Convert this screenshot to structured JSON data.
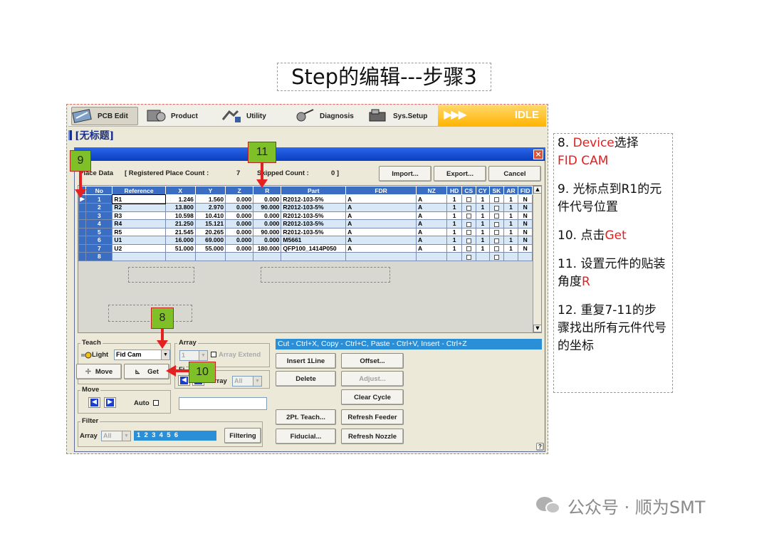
{
  "slide": {
    "title": "Step的编辑---步骤3"
  },
  "toolbar": {
    "tabs": [
      {
        "label": "PCB Edit",
        "icon": "pcb-edit-icon",
        "active": true
      },
      {
        "label": "Product",
        "icon": "product-icon",
        "active": false
      },
      {
        "label": "Utility",
        "icon": "utility-icon",
        "active": false
      },
      {
        "label": "Diagnosis",
        "icon": "diagnosis-icon",
        "active": false
      },
      {
        "label": "Sys.Setup",
        "icon": "sys-setup-icon",
        "active": false
      }
    ],
    "status_arrows": "▶▶▶",
    "status": "IDLE"
  },
  "document": {
    "label": "[无标题]"
  },
  "dialog": {
    "close_glyph": "×",
    "place_data_label": "Place Data",
    "registered_label": "[ Registered Place Count :",
    "registered_value": "7",
    "skipped_label": "Skipped Count :",
    "skipped_value": "0 ]",
    "import_label": "Import...",
    "export_label": "Export...",
    "cancel_label": "Cancel"
  },
  "table": {
    "columns": [
      "No",
      "Reference",
      "X",
      "Y",
      "Z",
      "R",
      "Part",
      "FDR",
      "NZ",
      "HD",
      "CS",
      "CY",
      "SK",
      "AR",
      "FID"
    ],
    "rows": [
      {
        "no": "1",
        "ref": "R1",
        "x": "1.246",
        "y": "1.560",
        "z": "0.000",
        "r": "0.000",
        "part": "R2012-103-5%",
        "fdr": "A",
        "nz": "A",
        "hd": "1",
        "cy": "1",
        "ar": "1",
        "fid": "N"
      },
      {
        "no": "2",
        "ref": "R2",
        "x": "13.800",
        "y": "2.970",
        "z": "0.000",
        "r": "90.000",
        "part": "R2012-103-5%",
        "fdr": "A",
        "nz": "A",
        "hd": "1",
        "cy": "1",
        "ar": "1",
        "fid": "N"
      },
      {
        "no": "3",
        "ref": "R3",
        "x": "10.598",
        "y": "10.410",
        "z": "0.000",
        "r": "0.000",
        "part": "R2012-103-5%",
        "fdr": "A",
        "nz": "A",
        "hd": "1",
        "cy": "1",
        "ar": "1",
        "fid": "N"
      },
      {
        "no": "4",
        "ref": "R4",
        "x": "21.250",
        "y": "15.121",
        "z": "0.000",
        "r": "0.000",
        "part": "R2012-103-5%",
        "fdr": "A",
        "nz": "A",
        "hd": "1",
        "cy": "1",
        "ar": "1",
        "fid": "N"
      },
      {
        "no": "5",
        "ref": "R5",
        "x": "21.545",
        "y": "20.265",
        "z": "0.000",
        "r": "90.000",
        "part": "R2012-103-5%",
        "fdr": "A",
        "nz": "A",
        "hd": "1",
        "cy": "1",
        "ar": "1",
        "fid": "N"
      },
      {
        "no": "6",
        "ref": "U1",
        "x": "16.000",
        "y": "69.000",
        "z": "0.000",
        "r": "0.000",
        "part": "M5661",
        "fdr": "A",
        "nz": "A",
        "hd": "1",
        "cy": "1",
        "ar": "1",
        "fid": "N"
      },
      {
        "no": "7",
        "ref": "U2",
        "x": "51.000",
        "y": "55.000",
        "z": "0.000",
        "r": "180.000",
        "part": "QFP100_1414P050",
        "fdr": "A",
        "nz": "A",
        "hd": "1",
        "cy": "1",
        "ar": "1",
        "fid": "N"
      },
      {
        "no": "8",
        "ref": "",
        "x": "",
        "y": "",
        "z": "",
        "r": "",
        "part": "",
        "fdr": "",
        "nz": "",
        "hd": "",
        "cy": "",
        "ar": "",
        "fid": ""
      }
    ]
  },
  "teach": {
    "title": "Teach",
    "light_label": "Light",
    "device_value": "Fid Cam",
    "move_label": "Move",
    "get_label": "Get"
  },
  "array": {
    "title": "Array",
    "combo_value": "1",
    "extend_label": "Array Extend",
    "find_title": "Fi",
    "array_label": "Array",
    "array_combo_value": "All"
  },
  "move_group": {
    "title": "Move",
    "auto_label": "Auto"
  },
  "filter": {
    "title": "Filter",
    "array_label": "Array",
    "combo_value": "All",
    "numbers": "1  2  3  4  5  6",
    "filtering_label": "Filtering"
  },
  "edit": {
    "shortcut_text": "Cut - Ctrl+X,  Copy - Ctrl+C,  Paste - Ctrl+V,  Insert - Ctrl+Z",
    "insert_label": "Insert 1Line",
    "delete_label": "Delete",
    "offset_label": "Offset...",
    "adjust_label": "Adjust...",
    "clear_cycle_label": "Clear Cycle",
    "teach2pt_label": "2Pt. Teach...",
    "refresh_feeder_label": "Refresh Feeder",
    "fiducial_label": "Fiducial...",
    "refresh_nozzle_label": "Refresh Nozzle",
    "help_glyph": "?"
  },
  "annotations": {
    "badge_9": "9",
    "badge_11": "11",
    "badge_8": "8",
    "badge_10": "10"
  },
  "notes": {
    "n8_prefix": "8. ",
    "n8_red1": "Device",
    "n8_mid": "选择",
    "n8_red2": "FID CAM",
    "n9": "9. 光标点到R1的元件代号位置",
    "n10_prefix": "10. 点击",
    "n10_red": "Get",
    "n11_prefix": "11. 设置元件的贴装角度",
    "n11_red": "R",
    "n12": "12. 重复7-11的步骤找出所有元件代号的坐标"
  },
  "watermark": {
    "text": "公众号 · 顺为SMT"
  },
  "colors": {
    "accent_red": "#e02020",
    "header_blue": "#3a6ec2",
    "badge_green": "#7fbf28",
    "idle_orange": "#ffb300"
  }
}
